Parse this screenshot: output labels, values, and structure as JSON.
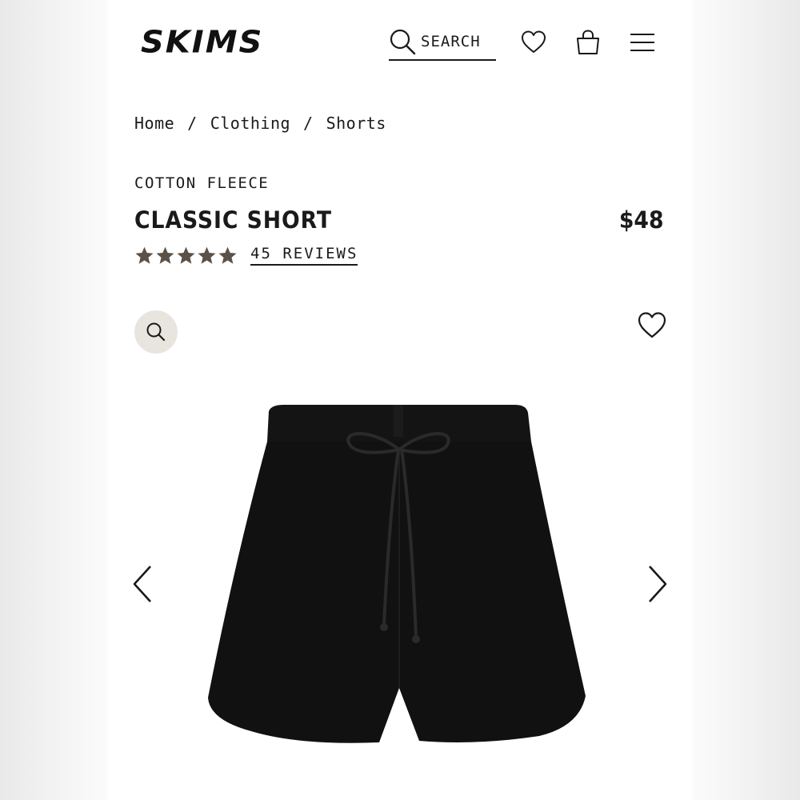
{
  "brand": {
    "logo_text": "SKIMS"
  },
  "header": {
    "search_label": "SEARCH",
    "icons": [
      "search-icon",
      "heart-icon",
      "shopping-bag-icon",
      "hamburger-menu-icon"
    ]
  },
  "breadcrumb": {
    "items": [
      "Home",
      "Clothing",
      "Shorts"
    ],
    "separator": "/"
  },
  "product": {
    "collection": "COTTON FLEECE",
    "name": "CLASSIC SHORT",
    "price": "$48",
    "rating": 5,
    "reviews_label": "45 REVIEWS",
    "image_icon": "black-fleece-shorts"
  },
  "gallery": {
    "zoom_icon": "magnifier-icon",
    "wishlist_icon": "heart-icon",
    "prev_icon": "chevron-left-icon",
    "next_icon": "chevron-right-icon"
  },
  "colors": {
    "text": "#1a1a1a",
    "star": "#5c5148",
    "zoom_bg": "#e8e5df",
    "product": "#111111"
  }
}
